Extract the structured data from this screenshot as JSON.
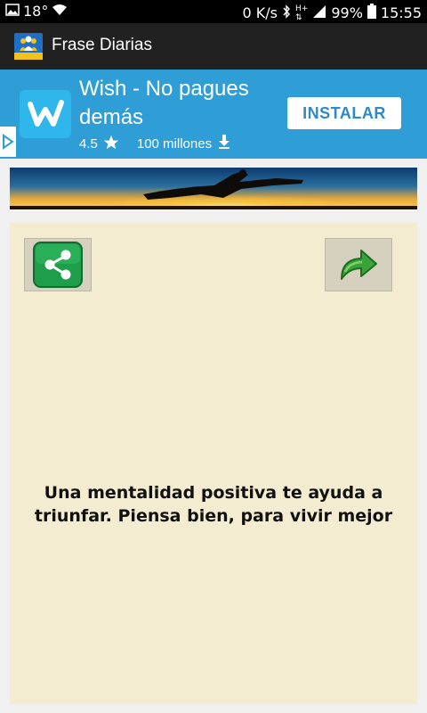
{
  "status_bar": {
    "temperature": "18°",
    "network_speed": "0 K/s",
    "battery": "99%",
    "time": "15:55"
  },
  "app_bar": {
    "title": "Frase Diarias"
  },
  "ad": {
    "title": "Wish - No pagues demás",
    "rating": "4.5",
    "downloads": "100 millones",
    "install_label": "INSTALAR",
    "logo_letter": "w"
  },
  "quote": {
    "text": "Una mentalidad positiva te ayuda a triunfar. Piensa bien, para vivir mejor"
  },
  "colors": {
    "ad_background": "#2f9ed6",
    "card_background": "#f3ecd0",
    "share_green": "#1e9e4a"
  },
  "icons": [
    "image-icon",
    "wifi-icon",
    "bluetooth-icon",
    "signal-icon",
    "battery-icon",
    "star-icon",
    "download-icon",
    "share-icon",
    "forward-arrow-icon",
    "adchoices-icon"
  ]
}
